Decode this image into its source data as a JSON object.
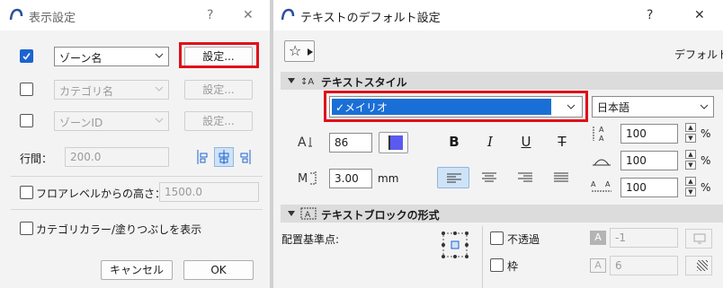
{
  "left_window": {
    "title": "表示設定",
    "help_label": "?",
    "close_label": "✕",
    "rows": [
      {
        "checked": true,
        "disabled": false,
        "select_value": "ゾーン名",
        "button_label": "設定..."
      },
      {
        "checked": false,
        "disabled": true,
        "select_value": "カテゴリ名",
        "button_label": "設定..."
      },
      {
        "checked": false,
        "disabled": true,
        "select_value": "ゾーンID",
        "button_label": "設定..."
      }
    ],
    "line_spacing_label": "行間：",
    "line_spacing_value": "200.0",
    "floor_level_label": "フロアレベルからの高さ：",
    "floor_level_value": "1500.0",
    "category_color_label": "カテゴリカラー/塗りつぶしを表示",
    "cancel_label": "キャンセル",
    "ok_label": "OK"
  },
  "right_window": {
    "title": "テキストのデフォルト設定",
    "help_label": "?",
    "close_label": "✕",
    "favorites_star": "☆",
    "default_label": "デフォルト",
    "text_style_section": "テキストスタイル",
    "font_value": "✓メイリオ",
    "language_value": "日本語",
    "font_size_value": "86",
    "pen_color": "#5a5af0",
    "bold_label": "B",
    "italic_label": "I",
    "underline_label": "U",
    "strike_label": "T",
    "width_value": "3.00",
    "width_unit": "mm",
    "spacing_values": [
      "100",
      "100",
      "100"
    ],
    "percent_label": "%",
    "text_block_section": "テキストブロックの形式",
    "anchor_label": "配置基準点:",
    "opaque_label": "不透過",
    "frame_label": "枠",
    "offset_value": "-1",
    "frame_width_value": "6"
  },
  "colors": {
    "accent": "#1c63d2",
    "highlight": "#e0101a",
    "selection": "#1a6fd6"
  }
}
